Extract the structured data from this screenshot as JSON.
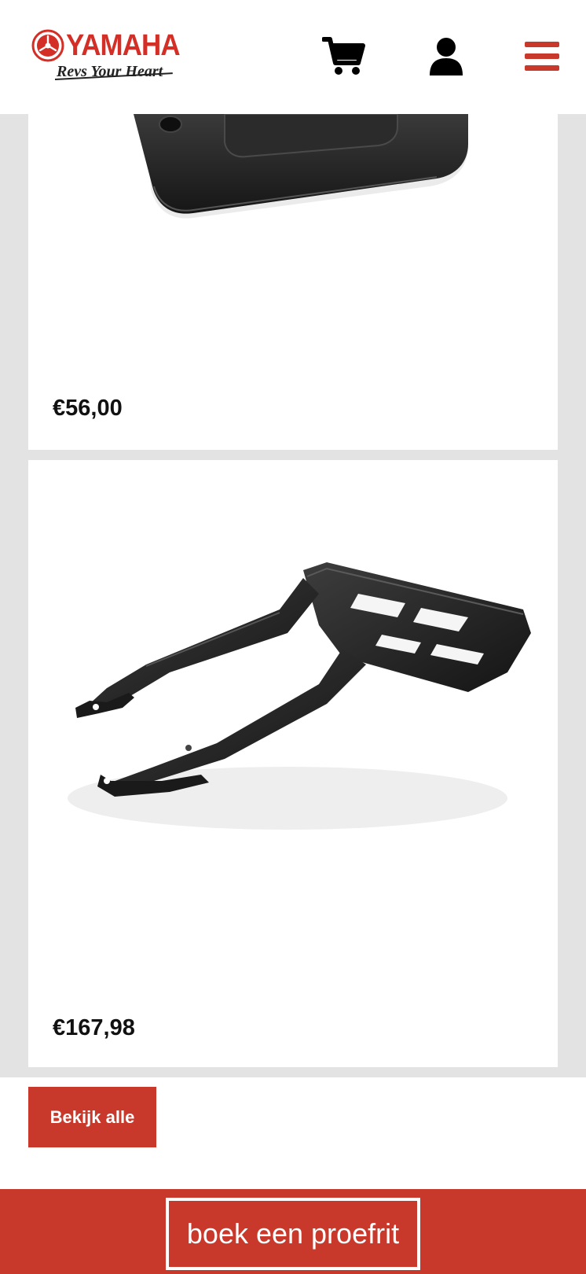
{
  "header": {
    "logo_text": "YAMAHA",
    "logo_tagline": "Revs Your Heart",
    "cart_icon": "shopping-cart-icon",
    "account_icon": "user-icon",
    "menu_icon": "hamburger-menu-icon"
  },
  "products": [
    {
      "price": "€56,00",
      "image": "black-brake-fluid-reservoir-cover"
    },
    {
      "price": "€167,98",
      "image": "black-rear-luggage-carrier-rack"
    }
  ],
  "actions": {
    "view_all_label": "Bekijk alle",
    "test_ride_label": "boek een proefrit"
  },
  "colors": {
    "brand_red": "#c8392c",
    "logo_red": "#d32f27",
    "backdrop_gray": "#e4e3e3",
    "text_dark": "#111111"
  }
}
